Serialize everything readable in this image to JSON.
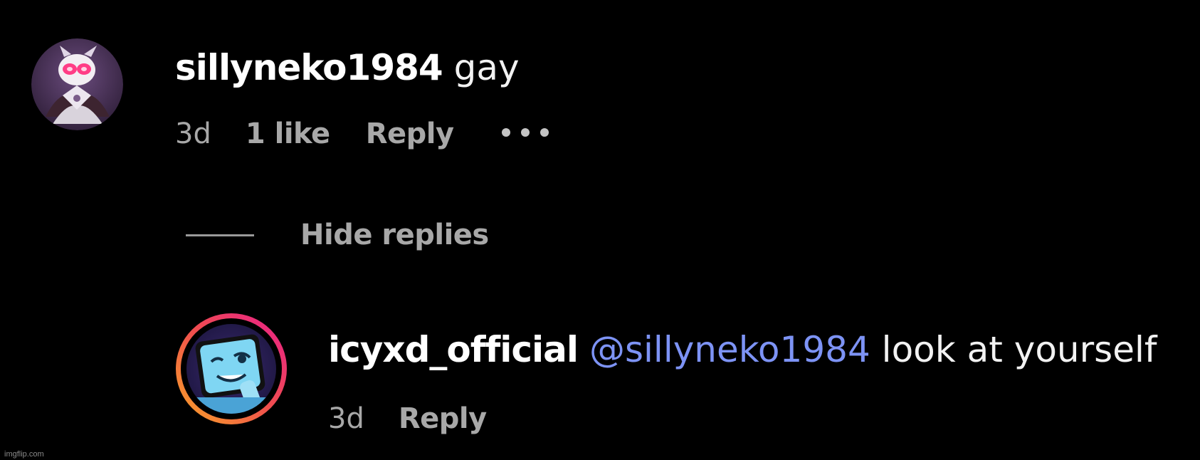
{
  "comment": {
    "username": "sillyneko1984",
    "text": "gay",
    "time": "3d",
    "likes": "1 like",
    "reply_label": "Reply",
    "more_icon": "more-horizontal-icon",
    "avatar_icon": "user-avatar"
  },
  "thread": {
    "hide_replies_label": "Hide replies"
  },
  "reply": {
    "username": "icyxd_official",
    "mention": "@sillyneko1984",
    "text": "look at yourself",
    "time": "3d",
    "reply_label": "Reply",
    "avatar_icon": "user-avatar-story-ring"
  },
  "watermark": "imgflip.com",
  "colors": {
    "background": "#000000",
    "mention": "#7d93f5",
    "meta": "#a8a8a8",
    "story_ring_start": "#f9a825",
    "story_ring_end": "#e91e8c"
  }
}
